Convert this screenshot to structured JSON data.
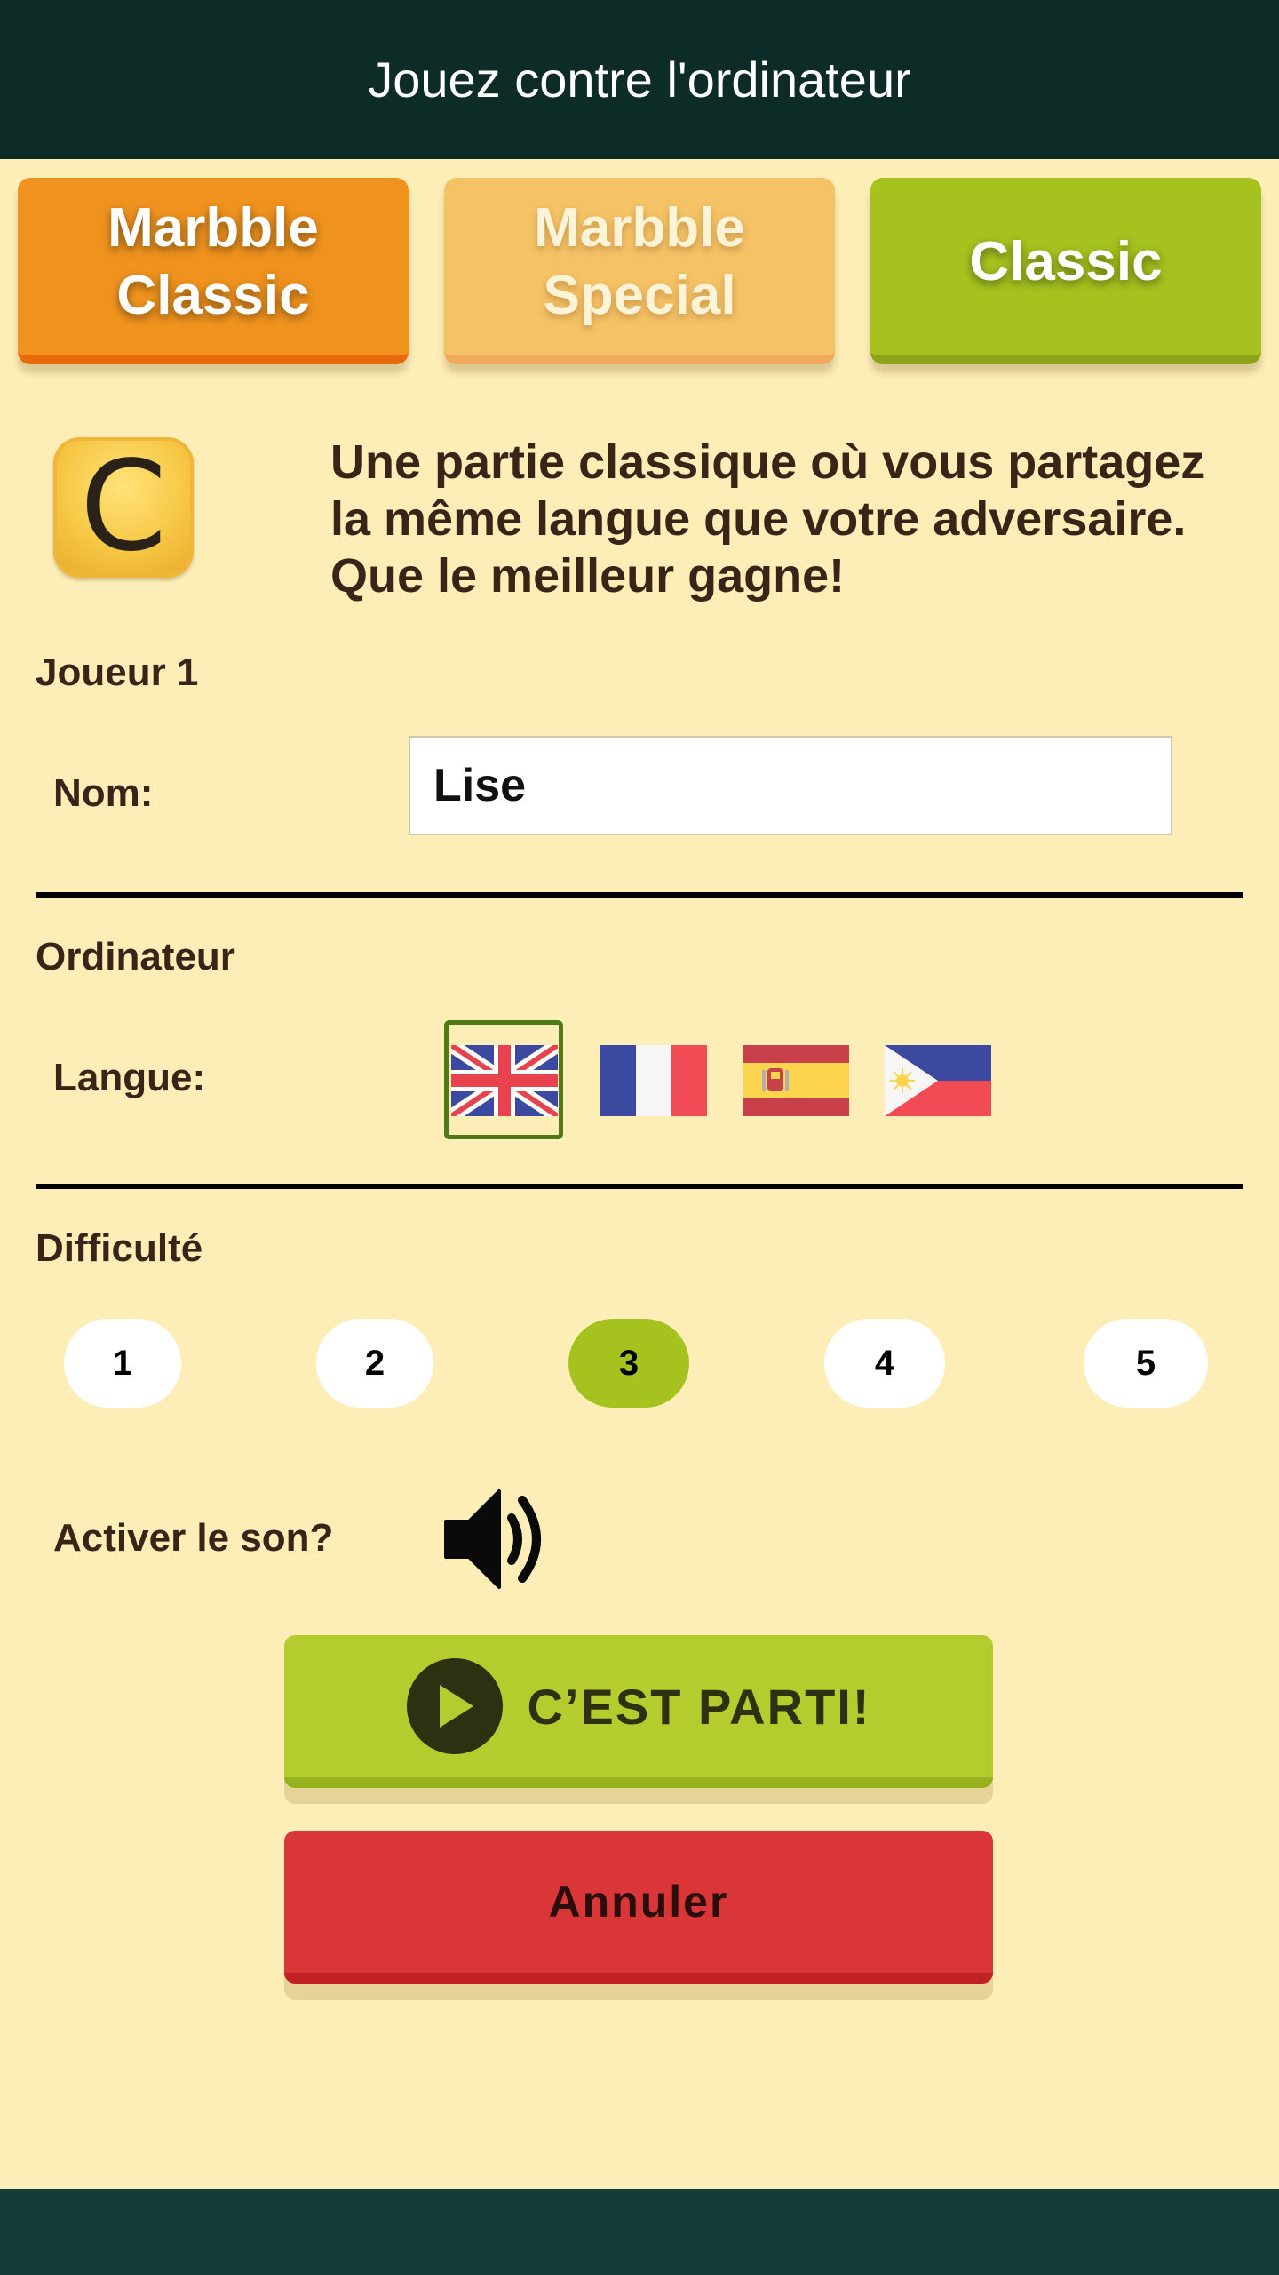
{
  "header": {
    "title": "Jouez contre l'ordinateur"
  },
  "mode_tabs": [
    {
      "line1": "Marbble",
      "line2": "Classic"
    },
    {
      "line1": "Marbble",
      "line2": "Special"
    },
    {
      "line1": "Classic"
    }
  ],
  "selected_mode": "Classic",
  "mode_icon": {
    "letter": "C"
  },
  "description": "Une partie classique où vous partagez la même langue que votre adversaire. Que le meilleur gagne!",
  "player": {
    "section_label": "Joueur 1",
    "name_label": "Nom:",
    "name_value": "Lise"
  },
  "computer": {
    "section_label": "Ordinateur",
    "language_label": "Langue:",
    "languages": [
      "uk-flag-icon",
      "france-flag-icon",
      "spain-flag-icon",
      "philippines-flag-icon"
    ],
    "selected_language": "uk-flag-icon"
  },
  "difficulty": {
    "section_label": "Difficulté",
    "levels": [
      "1",
      "2",
      "3",
      "4",
      "5"
    ],
    "selected": "3"
  },
  "sound": {
    "label": "Activer le son?",
    "icon": "speaker-icon"
  },
  "actions": {
    "go_label": "C’EST PARTI!",
    "cancel_label": "Annuler"
  },
  "colors": {
    "header_bg": "#0d2b27",
    "page_bg": "#fdeeb8",
    "accent_green": "#a6c21e",
    "orange": "#f0931e",
    "cancel_red": "#da3637"
  }
}
